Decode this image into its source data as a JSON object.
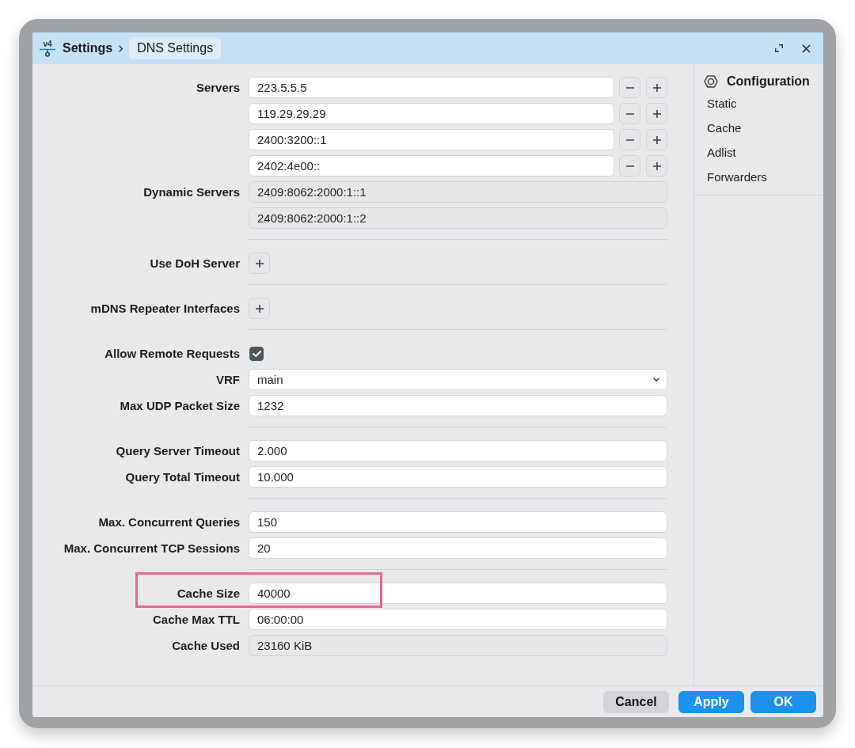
{
  "window": {
    "logo": "v4",
    "breadcrumb": [
      {
        "label": "Settings",
        "selected": false
      },
      {
        "label": "DNS Settings",
        "selected": true
      }
    ]
  },
  "form": {
    "sections": [
      {
        "rows": [
          {
            "kind": "editable_list",
            "label": "Servers",
            "values": [
              "223.5.5.5",
              "119.29.29.29",
              "2400:3200::1",
              "2402:4e00::"
            ],
            "highlighted": false
          },
          {
            "kind": "readonly_list",
            "label": "Dynamic Servers",
            "values": [
              "2409:8062:2000:1::1",
              "2409:8062:2000:1::2"
            ],
            "highlighted": false
          }
        ]
      },
      {
        "rows": [
          {
            "kind": "add",
            "label": "Use DoH Server",
            "highlighted": false
          }
        ]
      },
      {
        "rows": [
          {
            "kind": "add",
            "label": "mDNS Repeater Interfaces",
            "highlighted": false
          }
        ]
      },
      {
        "rows": [
          {
            "kind": "checkbox",
            "label": "Allow Remote Requests",
            "checked": true,
            "highlighted": false
          },
          {
            "kind": "select",
            "label": "VRF",
            "value": "main",
            "highlighted": false
          },
          {
            "kind": "text",
            "label": "Max UDP Packet Size",
            "value": "1232",
            "highlighted": false
          }
        ]
      },
      {
        "rows": [
          {
            "kind": "text",
            "label": "Query Server Timeout",
            "value": "2.000",
            "highlighted": false
          },
          {
            "kind": "text",
            "label": "Query Total Timeout",
            "value": "10.000",
            "highlighted": false
          }
        ]
      },
      {
        "rows": [
          {
            "kind": "text",
            "label": "Max. Concurrent Queries",
            "value": "150",
            "highlighted": false
          },
          {
            "kind": "text",
            "label": "Max. Concurrent TCP Sessions",
            "value": "20",
            "highlighted": false
          }
        ]
      },
      {
        "rows": [
          {
            "kind": "text",
            "label": "Cache Size",
            "value": "40000",
            "highlighted": true
          },
          {
            "kind": "text",
            "label": "Cache Max TTL",
            "value": "06:00:00",
            "highlighted": false
          },
          {
            "kind": "readonly",
            "label": "Cache Used",
            "value": "23160 KiB",
            "highlighted": false
          }
        ]
      }
    ]
  },
  "sidebar": {
    "title": "Configuration",
    "items": [
      "Static",
      "Cache",
      "Adlist",
      "Forwarders"
    ]
  },
  "buttons": [
    {
      "label": "Cancel",
      "kind": "secondary"
    },
    {
      "label": "Apply",
      "kind": "primary"
    },
    {
      "label": "OK",
      "kind": "primary"
    }
  ]
}
